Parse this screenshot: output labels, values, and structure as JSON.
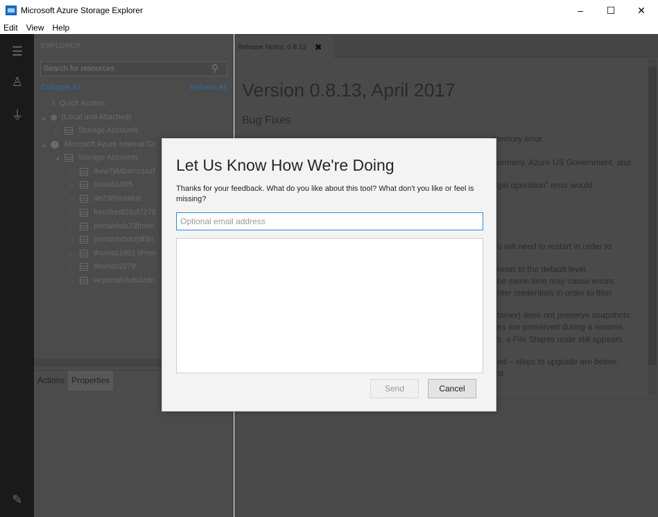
{
  "window": {
    "title": "Microsoft Azure Storage Explorer",
    "minimize": "–",
    "maximize": "☐",
    "close": "✕"
  },
  "menu": [
    "Edit",
    "View",
    "Help"
  ],
  "explorer": {
    "title": "EXPLORER",
    "search_placeholder": "Search for resources",
    "collapse_all": "Collapse All",
    "refresh_all": "Refresh All",
    "tree": [
      {
        "label": "Quick Access",
        "arrow": "",
        "icon": "quick-access"
      },
      {
        "label": "(Local and Attached)",
        "arrow": "◢",
        "icon": "local"
      },
      {
        "label": "Storage Accounts",
        "arrow": "▷",
        "icon": "table"
      },
      {
        "label": "Microsoft Azure Internal Cc",
        "arrow": "◢",
        "icon": "circle"
      },
      {
        "label": "Storage Accounts",
        "arrow": "◢",
        "icon": "table"
      },
      {
        "label": "4ww7j64beiccsazf",
        "arrow": "▷",
        "icon": "table"
      },
      {
        "label": "coslab1985",
        "arrow": "▷",
        "icon": "table"
      },
      {
        "label": "de2369eastus",
        "arrow": "▷",
        "icon": "table"
      },
      {
        "label": "function821cf7278",
        "arrow": "▷",
        "icon": "table"
      },
      {
        "label": "portalvhds73fmhn",
        "arrow": "▷",
        "icon": "table"
      },
      {
        "label": "portalvhds9zjdf3n",
        "arrow": "▷",
        "icon": "table"
      },
      {
        "label": "thomas1992 (Pren",
        "arrow": "▷",
        "icon": "table"
      },
      {
        "label": "thomas2279",
        "arrow": "▷",
        "icon": "table"
      },
      {
        "label": "wcportalvhdsdzdn",
        "arrow": "▷",
        "icon": "table"
      }
    ],
    "panel_tabs": [
      "Actions",
      "Properties"
    ]
  },
  "content": {
    "tab_label": "Release Notes: 0.8.13",
    "tab_close": "✖",
    "heading": "Version 0.8.13, April 2017",
    "subheading": "Bug Fixes",
    "visible_lines": [
      "memory error",
      "ermany, Azure US Government, and",
      "gal operation\" error would",
      "u will need to restart in order to",
      "reset to the default level.",
      "he same time may cause errors.",
      "nter credentials in order to filter",
      "tainer) does not preserve snapshots.",
      "es are preserved during a rename.",
      "s, a File Shares node still appears",
      "ed – steps to upgrade are below:",
      "st"
    ]
  },
  "dialog": {
    "title": "Let Us Know How We're Doing",
    "description": "Thanks for your feedback. What do you like about this tool? What don't you like or feel is missing?",
    "email_placeholder": "Optional email address",
    "send_label": "Send",
    "cancel_label": "Cancel"
  }
}
